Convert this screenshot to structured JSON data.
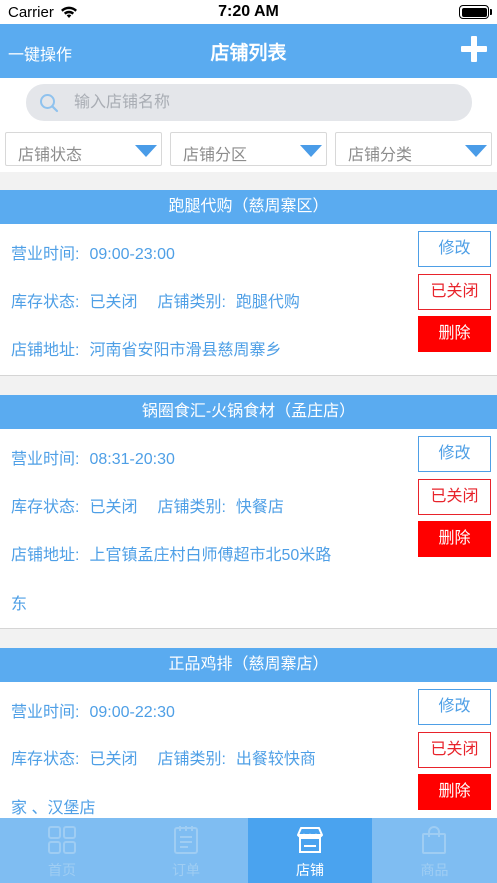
{
  "status_bar": {
    "carrier": "Carrier",
    "time": "7:20 AM"
  },
  "nav": {
    "left_action": "一键操作",
    "title": "店铺列表",
    "add_icon": "plus-icon"
  },
  "search": {
    "placeholder": "输入店铺名称",
    "value": ""
  },
  "filters": [
    {
      "label": "店铺状态"
    },
    {
      "label": "店铺分区"
    },
    {
      "label": "店铺分类"
    }
  ],
  "stores": [
    {
      "name": "跑腿代购（慈周寨区）",
      "hours_label": "营业时间:",
      "hours": "09:00-23:00",
      "stock_label": "库存状态:",
      "stock": "已关闭",
      "type_label": "店铺类别:",
      "type": "跑腿代购",
      "type_cont": "",
      "addr_label": "店铺地址:",
      "address": "河南省安阳市滑县慈周寨乡",
      "address_cont": "",
      "edit": "修改",
      "status": "已关闭",
      "delete": "删除"
    },
    {
      "name": "锅圈食汇-火锅食材（孟庄店）",
      "hours_label": "营业时间:",
      "hours": "08:31-20:30",
      "stock_label": "库存状态:",
      "stock": "已关闭",
      "type_label": "店铺类别:",
      "type": "快餐店",
      "type_cont": "",
      "addr_label": "店铺地址:",
      "address": "上官镇孟庄村白师傅超市北50米路",
      "address_cont": "东",
      "edit": "修改",
      "status": "已关闭",
      "delete": "删除"
    },
    {
      "name": "正品鸡排（慈周寨店）",
      "hours_label": "营业时间:",
      "hours": "09:00-22:30",
      "stock_label": "库存状态:",
      "stock": "已关闭",
      "type_label": "店铺类别:",
      "type": "出餐较快商",
      "type_cont": "家 、汉堡店",
      "addr_label": "",
      "address": "",
      "address_cont": "",
      "edit": "修改",
      "status": "已关闭",
      "delete": "删除"
    }
  ],
  "tabs": [
    {
      "label": "首页",
      "icon": "grid-icon",
      "active": false
    },
    {
      "label": "订单",
      "icon": "order-list-icon",
      "active": false
    },
    {
      "label": "店铺",
      "icon": "store-icon",
      "active": true
    },
    {
      "label": "商品",
      "icon": "shopping-bag-icon",
      "active": false
    }
  ],
  "colors": {
    "primary": "#5aabf0",
    "text_blue": "#4e9fe6",
    "danger": "#ff0000",
    "tab_bar": "#7fbdf2",
    "tab_active": "#4aa3ef"
  }
}
